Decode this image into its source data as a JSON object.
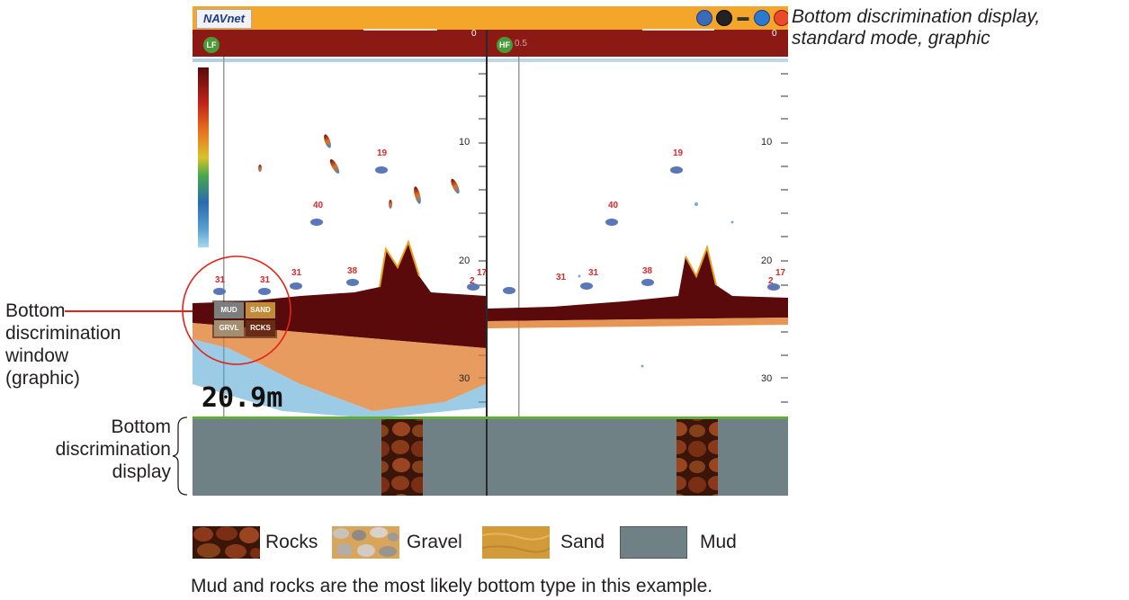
{
  "caption": {
    "title_line1": "Bottom discrimination display,",
    "title_line2": "standard mode, graphic"
  },
  "screen": {
    "brand": "NAVnet",
    "left_panel": {
      "badge": "LF",
      "depth_marks": [
        "0",
        "10",
        "20",
        "30"
      ]
    },
    "right_panel": {
      "badge": "HF",
      "top_label": "0.5",
      "depth_marks": [
        "0",
        "10",
        "20",
        "30"
      ]
    },
    "depth_readout": "20.9m",
    "fish_marks_left": [
      "19",
      "40",
      "31",
      "31",
      "31",
      "38",
      "17",
      "2"
    ],
    "fish_marks_right": [
      "19",
      "40",
      "31",
      "31",
      "38",
      "17",
      "2"
    ],
    "window_labels": [
      "MUD",
      "SAND",
      "GRVL",
      "RCKS"
    ],
    "header_icons": [
      "home-icon",
      "compass-icon",
      "ship-icon",
      "globe-icon",
      "power-icon"
    ]
  },
  "callouts": {
    "window": [
      "Bottom",
      "discrimination",
      "window",
      "(graphic)"
    ],
    "display": [
      "Bottom",
      "discrimination",
      "display"
    ]
  },
  "legend": [
    {
      "label": "Rocks",
      "color": "#7a2f14"
    },
    {
      "label": "Gravel",
      "color": "#b9a68a"
    },
    {
      "label": "Sand",
      "color": "#d39a3a"
    },
    {
      "label": "Mud",
      "color": "#6f8184"
    }
  ],
  "footnote": "Mud and rocks are the most likely bottom type in this example.",
  "colors": {
    "header_orange": "#f4a62a",
    "header_red": "#8c1a14",
    "mud": "#6f8184",
    "bottom_line": "#5a0a0a",
    "callout_red": "#e2231a",
    "divider_green": "#5fae3a"
  }
}
